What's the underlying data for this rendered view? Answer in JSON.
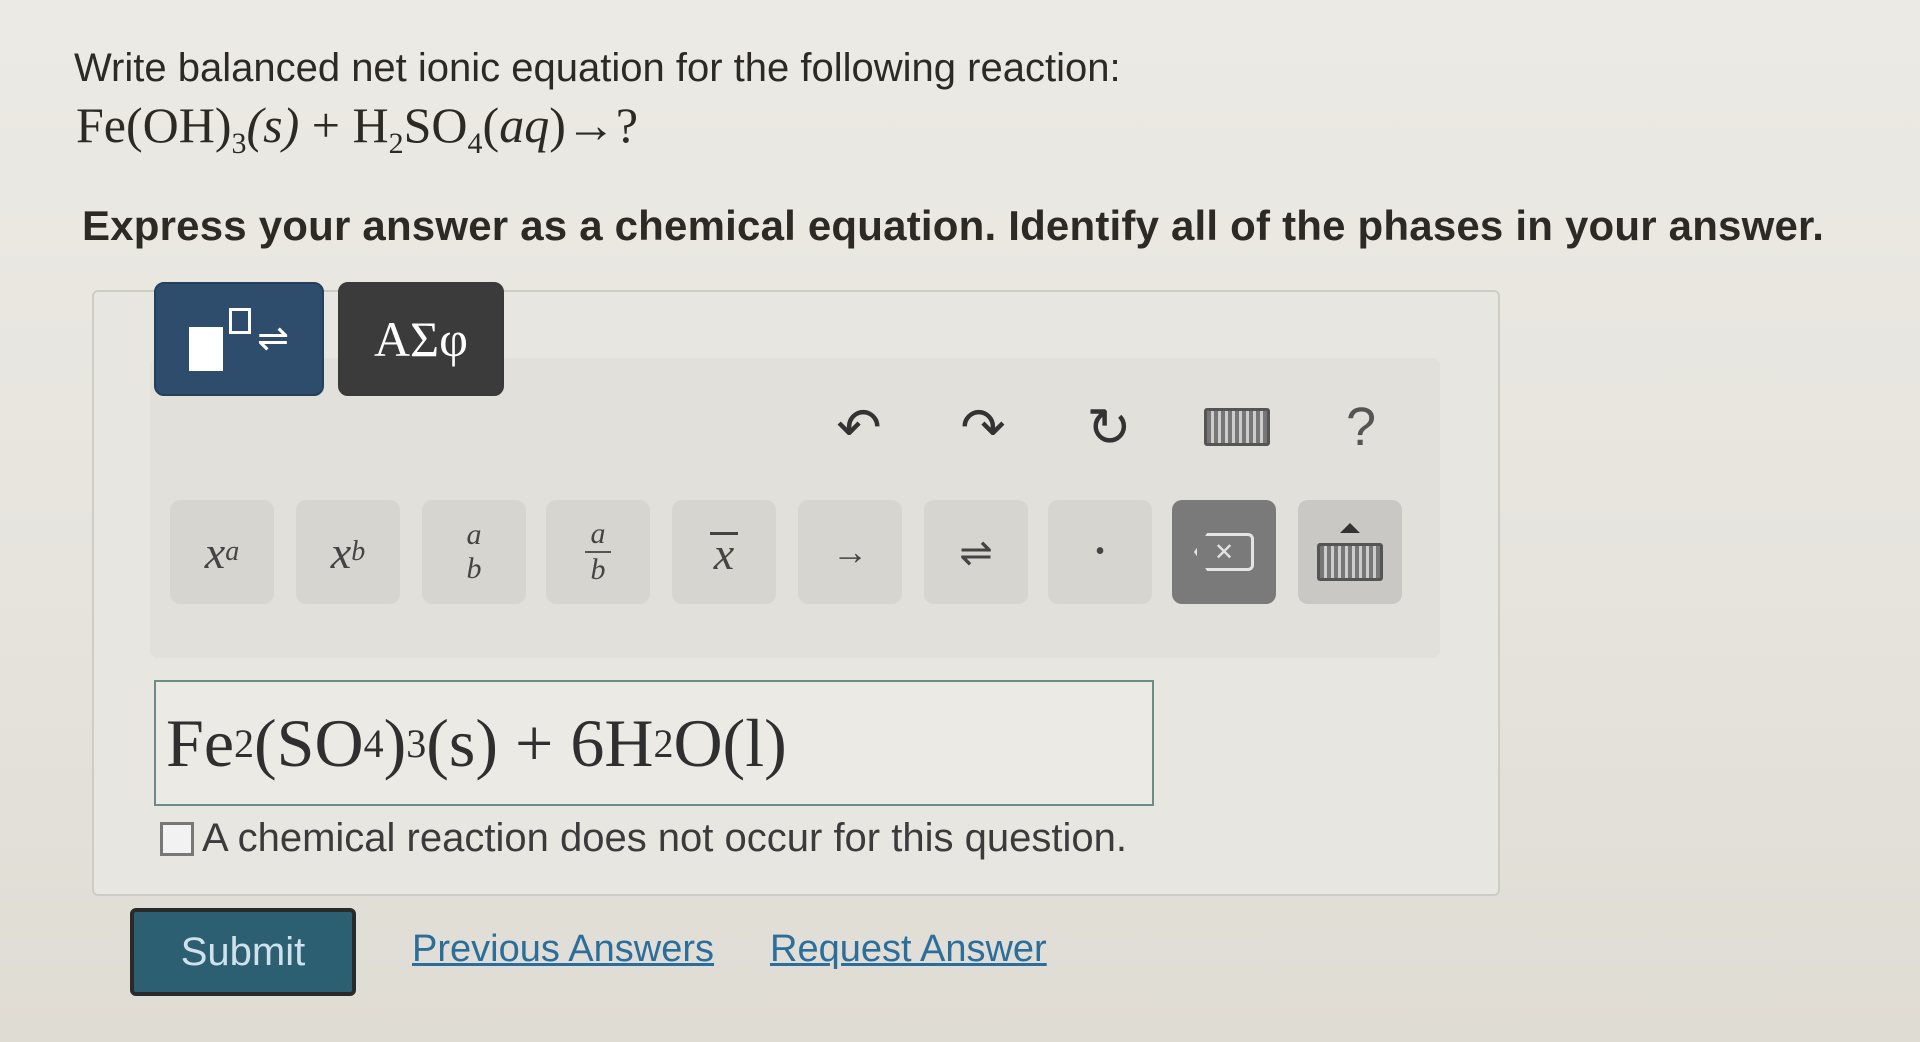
{
  "question": {
    "prompt": "Write balanced net ionic equation for the following reaction:",
    "reaction": {
      "r1": "Fe(OH)",
      "r1_sub": "3",
      "r1_phase": "(s)",
      "plus": "+",
      "r2a": "H",
      "r2a_sub": "2",
      "r2b": "SO",
      "r2b_sub": "4",
      "r2_phase": "aq",
      "arrow": "→?"
    },
    "instruction": "Express your answer as a chemical equation. Identify all of the phases in your answer."
  },
  "toolbar": {
    "tabs": [
      {
        "label": "templates-tab"
      },
      {
        "label": "ΑΣφ"
      }
    ],
    "actions": [
      "undo",
      "redo",
      "reset",
      "keyboard",
      "?"
    ],
    "keys": {
      "superscript": "x",
      "superscript_sup": "a",
      "subscript": "x",
      "subscript_sub": "b",
      "frac_num": "a",
      "frac_den": "b",
      "frac2_num": "a",
      "frac2_den": "b",
      "overline": "x",
      "arrow": "→",
      "equilibrium": "⇌",
      "dot": "•"
    },
    "help_label": "?"
  },
  "answer": {
    "p1": "Fe",
    "p1_sub": "2",
    "p2": "(SO",
    "p2_sub": "4",
    "p3": ")",
    "p3_sub": "3",
    "p4": "(s) + 6H",
    "p4_sub": "2",
    "p5": "O(l)"
  },
  "no_reaction_label": "A chemical reaction does not occur for this question.",
  "submit_label": "Submit",
  "links": {
    "previous": "Previous Answers",
    "request": "Request Answer"
  },
  "colors": {
    "submit": "#2d5f73",
    "templates_tab": "#2e4d6c",
    "link": "#2c6e9b"
  }
}
